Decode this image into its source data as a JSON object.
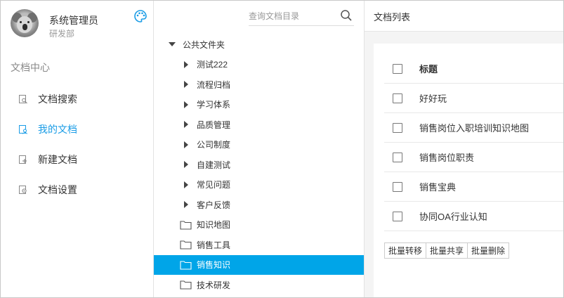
{
  "user": {
    "name": "系统管理员",
    "department": "研发部"
  },
  "sidebar": {
    "section_title": "文档中心",
    "items": [
      {
        "label": "文档搜索",
        "icon": "doc-search-icon",
        "active": false
      },
      {
        "label": "我的文档",
        "icon": "my-docs-icon",
        "active": true
      },
      {
        "label": "新建文档",
        "icon": "new-doc-icon",
        "active": false
      },
      {
        "label": "文档设置",
        "icon": "doc-settings-icon",
        "active": false
      }
    ]
  },
  "tree": {
    "search_placeholder": "查询文档目录",
    "root_label": "公共文件夹",
    "root_children": [
      "测试222",
      "流程归档",
      "学习体系",
      "品质管理",
      "公司制度",
      "自建测试",
      "常见问题",
      "客户反馈"
    ],
    "folders": [
      {
        "label": "知识地图",
        "selected": false
      },
      {
        "label": "销售工具",
        "selected": false
      },
      {
        "label": "销售知识",
        "selected": true
      },
      {
        "label": "技术研发",
        "selected": false
      }
    ]
  },
  "content": {
    "title": "文档列表",
    "table": {
      "header": "标题",
      "rows": [
        "好好玩",
        "销售岗位入职培训知识地图",
        "销售岗位职责",
        "销售宝典",
        "协同OA行业认知"
      ]
    },
    "actions": {
      "move": "批量转移",
      "share": "批量共享",
      "delete": "批量删除"
    }
  },
  "colors": {
    "accent": "#1a9ce6",
    "selected_bg": "#00a5e8"
  }
}
